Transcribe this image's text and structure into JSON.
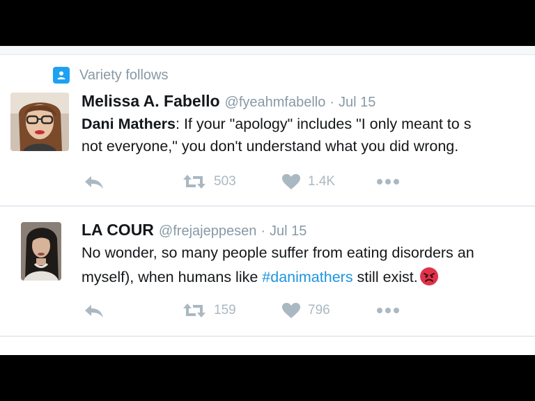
{
  "social_context": {
    "icon": "follow-icon",
    "text": "Variety follows"
  },
  "tweets": [
    {
      "name": "Melissa A. Fabello",
      "handle": "@fyeahmfabello",
      "sep": "·",
      "time": "Jul 15",
      "line1_bold": "Dani Mathers",
      "line1_rest": ": If your \"apology\" includes \"I only meant to s",
      "line2": "not everyone,\" you don't understand what you did wrong.",
      "retweets": "503",
      "likes": "1.4K"
    },
    {
      "name": "LA COUR",
      "handle": "@frejajeppesen",
      "sep": "·",
      "time": "Jul 15",
      "line1": "No wonder, so many people suffer from eating disorders an",
      "line2_pre": "myself), when humans like ",
      "line2_hashtag": "#danimathers",
      "line2_post": " still exist.",
      "emoji": "angry-face-emoji",
      "retweets": "159",
      "likes": "796"
    }
  ],
  "colors": {
    "accent": "#1da1f2",
    "hashtag": "#1b95e0",
    "muted": "#8899a6",
    "icon": "#aab8c2",
    "text": "#14171a"
  }
}
